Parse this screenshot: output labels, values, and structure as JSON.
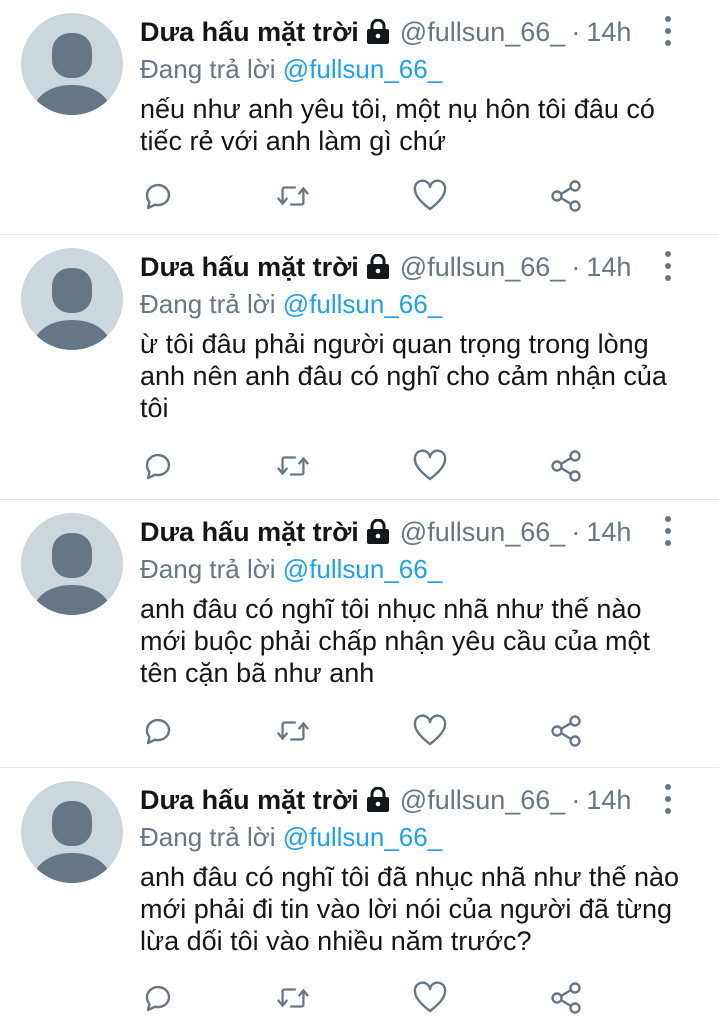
{
  "tweets": [
    {
      "name": "Dưa hấu mặt trời",
      "handle": "@fullsun_66_",
      "dot": "·",
      "time": "14h",
      "reply_prefix": "Đang trả lời",
      "reply_to": "@fullsun_66_",
      "text": "nếu như anh yêu tôi, một nụ hôn tôi đâu có tiếc rẻ với anh làm gì chứ"
    },
    {
      "name": "Dưa hấu mặt trời",
      "handle": "@fullsun_66_",
      "dot": "·",
      "time": "14h",
      "reply_prefix": "Đang trả lời",
      "reply_to": "@fullsun_66_",
      "text": "ừ tôi đâu phải người quan trọng trong lòng anh nên anh đâu có nghĩ cho cảm nhận của tôi"
    },
    {
      "name": "Dưa hấu mặt trời",
      "handle": "@fullsun_66_",
      "dot": "·",
      "time": "14h",
      "reply_prefix": "Đang trả lời",
      "reply_to": "@fullsun_66_",
      "text": "anh đâu có nghĩ tôi nhục nhã như thế nào mới buộc phải chấp nhận yêu cầu của một tên cặn bã như anh"
    },
    {
      "name": "Dưa hấu mặt trời",
      "handle": "@fullsun_66_",
      "dot": "·",
      "time": "14h",
      "reply_prefix": "Đang trả lời",
      "reply_to": "@fullsun_66_",
      "text": "anh đâu có nghĩ tôi đã nhục nhã như thế nào mới phải đi tin vào lời nói của người đã từng lừa dối tôi vào nhiều năm trước?"
    }
  ],
  "icons": {
    "lock": "lock-icon",
    "more": "more-vertical-icon",
    "reply": "reply-icon",
    "retweet": "retweet-icon",
    "like": "heart-icon",
    "share": "share-icon"
  },
  "colors": {
    "text": "#14171a",
    "secondary": "#657786",
    "mention": "#1da1f2",
    "divider": "#e1e8ed",
    "avatar_bg": "#ccd6dd",
    "avatar_fg": "#657786"
  }
}
